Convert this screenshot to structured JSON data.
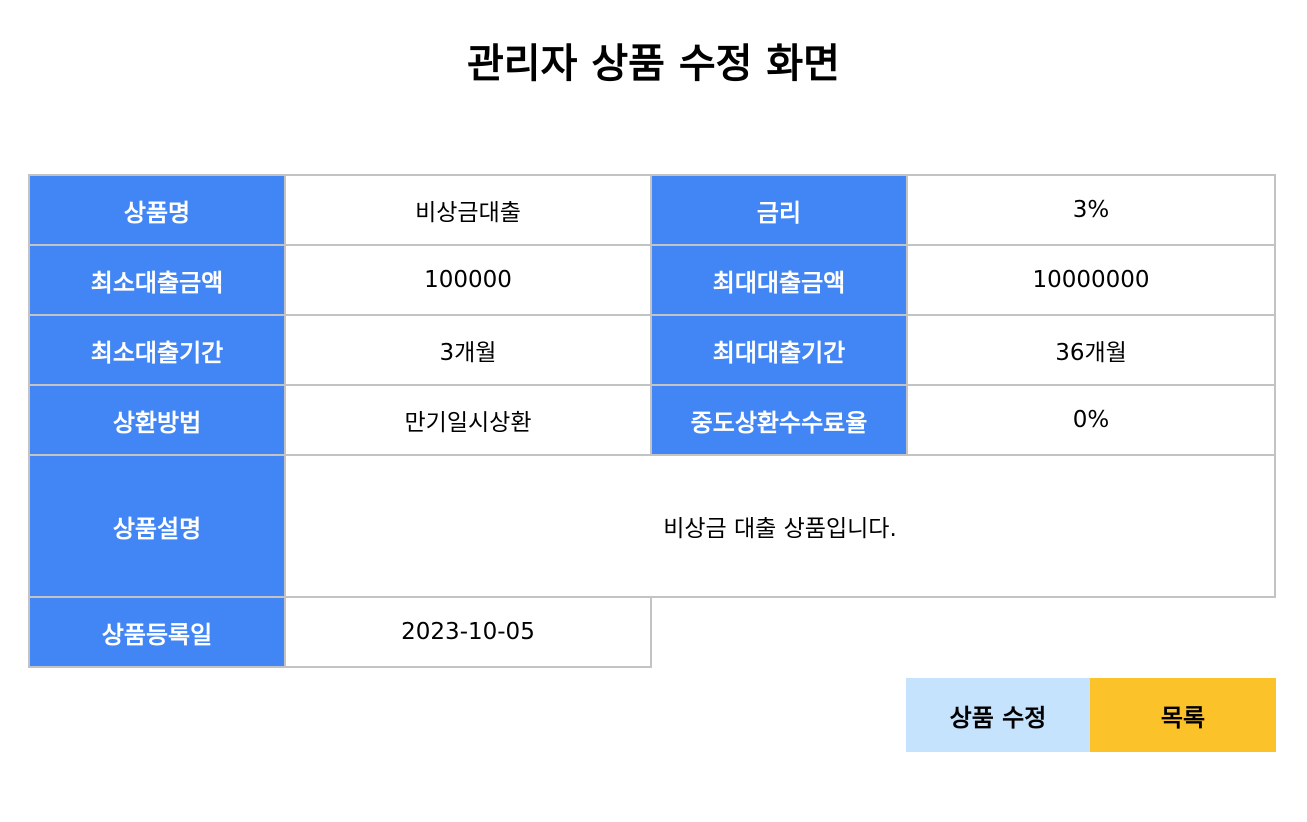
{
  "page": {
    "title": "관리자 상품 수정 화면"
  },
  "fields": {
    "product_name": {
      "label": "상품명",
      "value": "비상금대출"
    },
    "interest_rate": {
      "label": "금리",
      "value": "3%"
    },
    "min_amount": {
      "label": "최소대출금액",
      "value": "100000"
    },
    "max_amount": {
      "label": "최대대출금액",
      "value": "10000000"
    },
    "min_period": {
      "label": "최소대출기간",
      "value": "3개월"
    },
    "max_period": {
      "label": "최대대출기간",
      "value": "36개월"
    },
    "repayment_method": {
      "label": "상환방법",
      "value": "만기일시상환"
    },
    "prepayment_fee_rate": {
      "label": "중도상환수수료율",
      "value": "0%"
    },
    "description": {
      "label": "상품설명",
      "value": "비상금 대출 상품입니다."
    },
    "registered_date": {
      "label": "상품등록일",
      "value": "2023-10-05"
    }
  },
  "actions": {
    "edit_label": "상품 수정",
    "list_label": "목록"
  },
  "colors": {
    "label_bg": "#4285f4",
    "edit_button_bg": "#c5e3fc",
    "list_button_bg": "#fcc22a",
    "border": "#c3c3c3"
  }
}
